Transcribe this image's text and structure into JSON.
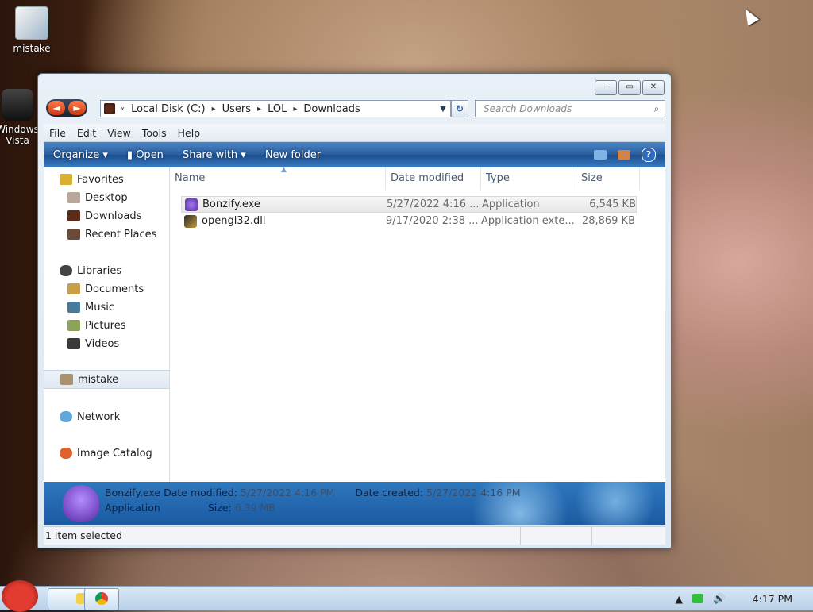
{
  "desktop": {
    "icons": [
      {
        "label": "mistake"
      },
      {
        "label": "Windows Vista"
      }
    ]
  },
  "window": {
    "caption_buttons": {
      "minimize": "–",
      "maximize": "▭",
      "close": "✕"
    },
    "nav": {
      "back": "◄",
      "forward": "►"
    },
    "address": {
      "overflow": "«",
      "crumbs": [
        "Local Disk (C:)",
        "Users",
        "LOL",
        "Downloads"
      ],
      "dropdown": "▼"
    },
    "refresh": "↻",
    "search": {
      "placeholder": "Search Downloads",
      "icon": "⌕"
    },
    "menu": [
      "File",
      "Edit",
      "View",
      "Tools",
      "Help"
    ],
    "toolbar": {
      "organize": "Organize ▾",
      "open": "Open",
      "share_with": "Share with ▾",
      "new_folder": "New folder",
      "help": "?"
    },
    "nav_pane": {
      "favorites": {
        "label": "Favorites",
        "items": [
          "Desktop",
          "Downloads",
          "Recent Places"
        ]
      },
      "libraries": {
        "label": "Libraries",
        "items": [
          "Documents",
          "Music",
          "Pictures",
          "Videos"
        ]
      },
      "mistake": "mistake",
      "network": "Network",
      "image_catalog": "Image Catalog"
    },
    "columns": [
      "Name",
      "Date modified",
      "Type",
      "Size"
    ],
    "files": [
      {
        "name": "Bonzify.exe",
        "date": "5/27/2022 4:16 ...",
        "type": "Application",
        "size": "6,545 KB",
        "selected": true,
        "icon": "bonzi-icon"
      },
      {
        "name": "opengl32.dll",
        "date": "9/17/2020 2:38 ...",
        "type": "Application exte...",
        "size": "28,869 KB",
        "selected": false,
        "icon": "dll-icon"
      }
    ],
    "details": {
      "name": "Bonzify.exe",
      "type": "Application",
      "date_modified_label": "Date modified:",
      "date_modified": "5/27/2022 4:16 PM",
      "size_label": "Size:",
      "size": "6.39 MB",
      "date_created_label": "Date created:",
      "date_created": "5/27/2022 4:16 PM"
    },
    "status": "1 item selected"
  },
  "taskbar": {
    "clock": "4:17 PM",
    "tray_arrow": "▲",
    "volume": "🔊"
  }
}
